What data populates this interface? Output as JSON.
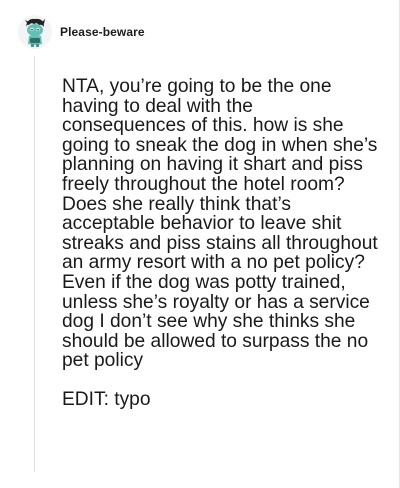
{
  "comment": {
    "username": "Please-beware",
    "avatar_icon": "snoo-avatar-icon",
    "body": "NTA, you’re going to be the one having to deal with the consequences of this. how is she going to sneak the dog in when she’s planning on having it shart and piss freely throughout the hotel room? Does she really think that’s acceptable behavior to leave shit streaks and piss stains all throughout an army resort with a no pet policy? Even if the dog was potty trained, unless she’s royalty or has a service dog I don’t see why she thinks she should be allowed to surpass the no pet policy",
    "edit_note": "EDIT: typo"
  },
  "colors": {
    "text": "#1a1a1b",
    "thread_line": "#e3e3e3",
    "avatar_body": "#5ec2b7",
    "avatar_hair": "#222222"
  }
}
